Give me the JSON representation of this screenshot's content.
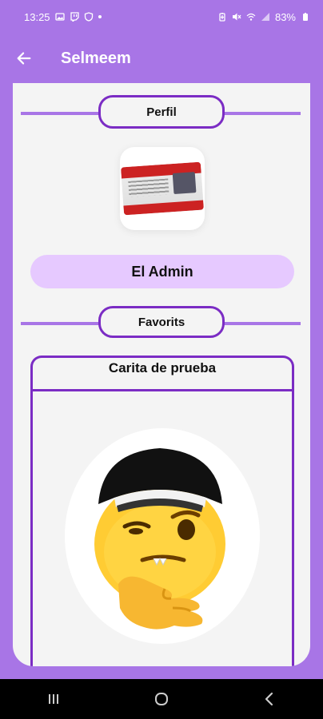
{
  "status_bar": {
    "time": "13:25",
    "battery": "83%",
    "left_icons": [
      "image-icon",
      "twitch-icon",
      "shield-icon"
    ],
    "right_icons": [
      "battery-saver-icon",
      "mute-icon",
      "wifi-icon",
      "signal-icon",
      "battery-icon"
    ]
  },
  "app_bar": {
    "title": "Selmeem",
    "back_icon": "arrow-left-icon"
  },
  "profile": {
    "section_label": "Perfil",
    "avatar": "license-card-image",
    "name": "El Admin"
  },
  "favorites": {
    "section_label": "Favorits",
    "items": [
      {
        "title": "Carita de prueba",
        "image": "smirking-emoji-with-cap"
      }
    ]
  },
  "nav_bar": {
    "buttons": [
      "recents-icon",
      "home-icon",
      "back-icon"
    ]
  },
  "colors": {
    "accent": "#a875e6",
    "border": "#7b2cc4",
    "name_pill": "#e6c9ff",
    "background": "#f4f4f4"
  }
}
